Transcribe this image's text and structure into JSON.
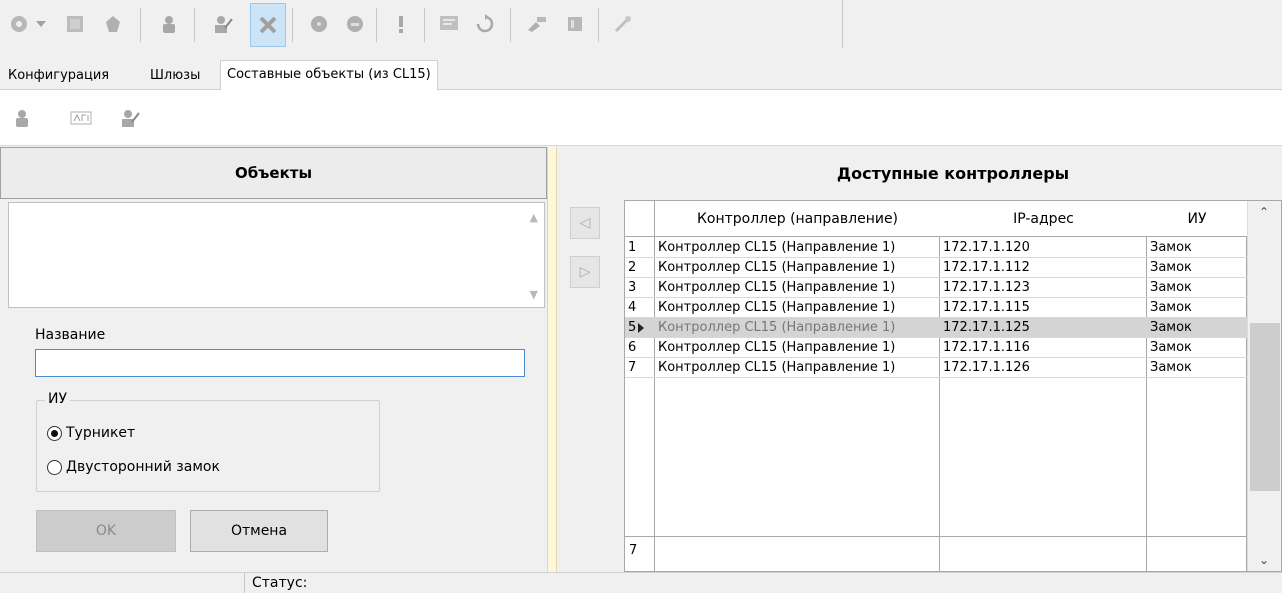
{
  "toolbar": {
    "icons": [
      "add-icon",
      "dropdown-arrow-icon",
      "image-icon",
      "shape-icon",
      "person-icon",
      "edit-person-icon",
      "delete-icon",
      "circle-icon",
      "circle-alt-icon",
      "exclamation-icon",
      "map-icon",
      "refresh-icon",
      "brush-icon",
      "panel-icon",
      "link-icon"
    ]
  },
  "tabs": [
    "Конфигурация",
    "Шлюзы",
    "Составные объекты (из CL15)"
  ],
  "left_panel": {
    "title": "Объекты",
    "name_label": "Название",
    "name_value": "",
    "iu_group_label": "ИУ",
    "radio_turnstile": "Турникет",
    "radio_double_lock": "Двусторонний замок",
    "ok_label": "OK",
    "cancel_label": "Отмена"
  },
  "right_panel": {
    "title": "Доступные контроллеры",
    "columns": [
      "Контроллер (направление)",
      "IP-адрес",
      "ИУ"
    ],
    "rows": [
      {
        "n": "1",
        "controller": "Контроллер CL15 (Направление 1)",
        "ip": "172.17.1.120",
        "iu": "Замок"
      },
      {
        "n": "2",
        "controller": "Контроллер CL15 (Направление 1)",
        "ip": "172.17.1.112",
        "iu": "Замок"
      },
      {
        "n": "3",
        "controller": "Контроллер CL15 (Направление 1)",
        "ip": "172.17.1.123",
        "iu": "Замок"
      },
      {
        "n": "4",
        "controller": "Контроллер CL15 (Направление 1)",
        "ip": "172.17.1.115",
        "iu": "Замок"
      },
      {
        "n": "5",
        "controller": "Контроллер CL15 (Направление 1)",
        "ip": "172.17.1.125",
        "iu": "Замок"
      },
      {
        "n": "6",
        "controller": "Контроллер CL15 (Направление 1)",
        "ip": "172.17.1.116",
        "iu": "Замок"
      },
      {
        "n": "7",
        "controller": "Контроллер CL15 (Направление 1)",
        "ip": "172.17.1.126",
        "iu": "Замок"
      }
    ],
    "selected_row": "5",
    "footer_count": "7"
  },
  "status": {
    "label": "Статус:"
  },
  "colors": {
    "active_button": "#cce4f7",
    "input_focus": "#4a8bd0",
    "splitter": "#fff8d8",
    "selected_row": "#d4d4d4"
  }
}
